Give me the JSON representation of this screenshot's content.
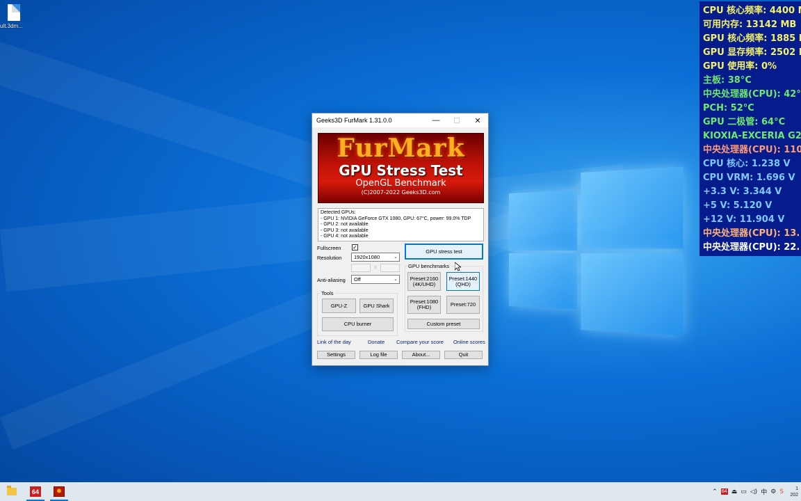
{
  "desktop": {
    "icon_label": "ult.3dm..."
  },
  "sensor_overlay": {
    "rows": [
      {
        "text": "CPU 核心频率: 4400 M",
        "color": "#f2f26a"
      },
      {
        "text": "可用内存: 13142 MB",
        "color": "#f2f26a"
      },
      {
        "text": "GPU 核心频率: 1885 N",
        "color": "#f2f26a"
      },
      {
        "text": "GPU 显存频率: 2502 N",
        "color": "#f2f26a"
      },
      {
        "text": "GPU 使用率: 0%",
        "color": "#f2f26a"
      },
      {
        "text": "主板: 38°C",
        "color": "#6ee86e"
      },
      {
        "text": "中央处理器(CPU): 42°",
        "color": "#6ee86e"
      },
      {
        "text": "PCH: 52°C",
        "color": "#6ee86e"
      },
      {
        "text": "GPU 二极管: 64°C",
        "color": "#6ee86e"
      },
      {
        "text": "KIOXIA-EXCERIA G2 S",
        "color": "#6ee86e"
      },
      {
        "text": "中央处理器(CPU): 110",
        "color": "#ff9a7a"
      },
      {
        "text": "CPU 核心: 1.238 V",
        "color": "#7fc8ff"
      },
      {
        "text": "CPU VRM: 1.696 V",
        "color": "#7fc8ff"
      },
      {
        "text": "+3.3 V: 3.344 V",
        "color": "#7fc8ff"
      },
      {
        "text": "+5 V: 5.120 V",
        "color": "#7fc8ff"
      },
      {
        "text": "+12 V: 11.904 V",
        "color": "#7fc8ff"
      },
      {
        "text": "中央处理器(CPU): 13.",
        "color": "#ffb27a"
      },
      {
        "text": "中央处理器(CPU): 22.",
        "color": "#ffffff"
      }
    ]
  },
  "furmark": {
    "title": "Geeks3D FurMark 1.31.0.0",
    "controls": {
      "minimize": "—",
      "maximize": "☐",
      "close": "✕"
    },
    "banner": {
      "logo": "FurMark",
      "subtitle": "GPU Stress Test",
      "subtitle2": "OpenGL Benchmark",
      "copyright": "(C)2007-2022 Geeks3D.com"
    },
    "gpu_info": {
      "header": "Detected GPUs:",
      "lines": [
        "- GPU 1: NVIDIA GeForce GTX 1080, GPU: 67°C, power: 99.0% TDP",
        "- GPU 2: not available",
        "- GPU 3: not available",
        "- GPU 4: not available"
      ]
    },
    "fullscreen_label": "Fullscreen",
    "fullscreen_checked": true,
    "resolution_label": "Resolution",
    "resolution_value": "1920x1080",
    "antialiasing_label": "Anti-aliasing",
    "antialiasing_value": "Off",
    "tools_label": "Tools",
    "gpuz_button": "GPU-Z",
    "gpushark_button": "GPU Shark",
    "cpuburner_button": "CPU burner",
    "stress_test_button": "GPU stress test",
    "benchmarks_label": "GPU benchmarks",
    "presets": {
      "p2160": "Preset:2160\n(4K/UHD)",
      "p1440": "Preset:1440\n(QHD)",
      "p1080": "Preset:1080\n(FHD)",
      "p720": "Preset:720"
    },
    "custom_preset_button": "Custom preset",
    "links": {
      "link_of_day": "Link of the day",
      "donate": "Donate",
      "compare": "Compare your score",
      "online": "Online scores"
    },
    "bottom_buttons": {
      "settings": "Settings",
      "logfile": "Log file",
      "about": "About...",
      "quit": "Quit"
    }
  },
  "taskbar": {
    "aida_label": "64",
    "tray_ime": "中",
    "clock_time": "1",
    "clock_date": "202"
  }
}
